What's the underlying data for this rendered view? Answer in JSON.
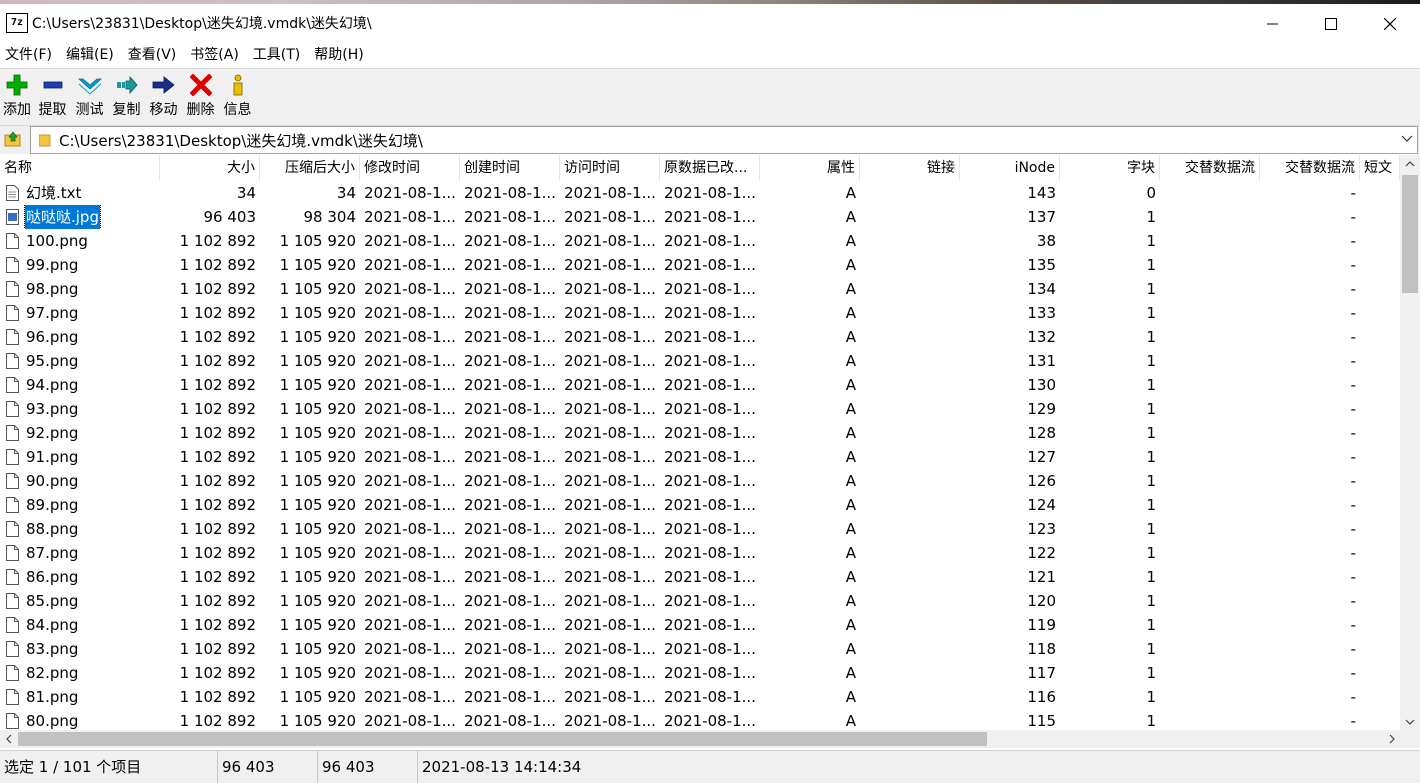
{
  "window": {
    "app_icon_text": "7z",
    "title": "C:\\Users\\23831\\Desktop\\迷失幻境.vmdk\\迷失幻境\\"
  },
  "menu": [
    "文件(F)",
    "编辑(E)",
    "查看(V)",
    "书签(A)",
    "工具(T)",
    "帮助(H)"
  ],
  "toolbar": [
    {
      "label": "添加",
      "icon": "add-icon",
      "color": "#00b000"
    },
    {
      "label": "提取",
      "icon": "extract-icon",
      "color": "#1a3fb5"
    },
    {
      "label": "测试",
      "icon": "test-icon",
      "color": "#00a0c8"
    },
    {
      "label": "复制",
      "icon": "copy-icon",
      "color": "#1a9a9a"
    },
    {
      "label": "移动",
      "icon": "move-icon",
      "color": "#1a2f8a"
    },
    {
      "label": "删除",
      "icon": "delete-icon",
      "color": "#e00000"
    },
    {
      "label": "信息",
      "icon": "info-icon",
      "color": "#e8c000"
    }
  ],
  "address": {
    "path": "C:\\Users\\23831\\Desktop\\迷失幻境.vmdk\\迷失幻境\\"
  },
  "columns": [
    "名称",
    "大小",
    "压缩后大小",
    "修改时间",
    "创建时间",
    "访问时间",
    "原数据已改...",
    "属性",
    "链接",
    "iNode",
    "字块",
    "交替数据流",
    "交替数据流",
    "短文"
  ],
  "rows": [
    {
      "name": "幻境.txt",
      "size": "34",
      "packed": "34",
      "modified": "2021-08-1...",
      "created": "2021-08-1...",
      "accessed": "2021-08-1...",
      "changed": "2021-08-1...",
      "attr": "A",
      "links": "",
      "inode": "143",
      "blocks": "0",
      "alt1": "",
      "alt2": "-",
      "short": "",
      "type": "txt"
    },
    {
      "name": "哒哒哒.jpg",
      "size": "96 403",
      "packed": "98 304",
      "modified": "2021-08-1...",
      "created": "2021-08-1...",
      "accessed": "2021-08-1...",
      "changed": "2021-08-1...",
      "attr": "A",
      "links": "",
      "inode": "137",
      "blocks": "1",
      "alt1": "",
      "alt2": "-",
      "short": "",
      "type": "jpg",
      "selected": true
    },
    {
      "name": "100.png",
      "size": "1 102 892",
      "packed": "1 105 920",
      "modified": "2021-08-1...",
      "created": "2021-08-1...",
      "accessed": "2021-08-1...",
      "changed": "2021-08-1...",
      "attr": "A",
      "links": "",
      "inode": "38",
      "blocks": "1",
      "alt1": "",
      "alt2": "-",
      "short": "",
      "type": "png"
    },
    {
      "name": "99.png",
      "size": "1 102 892",
      "packed": "1 105 920",
      "modified": "2021-08-1...",
      "created": "2021-08-1...",
      "accessed": "2021-08-1...",
      "changed": "2021-08-1...",
      "attr": "A",
      "links": "",
      "inode": "135",
      "blocks": "1",
      "alt1": "",
      "alt2": "-",
      "short": "",
      "type": "png"
    },
    {
      "name": "98.png",
      "size": "1 102 892",
      "packed": "1 105 920",
      "modified": "2021-08-1...",
      "created": "2021-08-1...",
      "accessed": "2021-08-1...",
      "changed": "2021-08-1...",
      "attr": "A",
      "links": "",
      "inode": "134",
      "blocks": "1",
      "alt1": "",
      "alt2": "-",
      "short": "",
      "type": "png"
    },
    {
      "name": "97.png",
      "size": "1 102 892",
      "packed": "1 105 920",
      "modified": "2021-08-1...",
      "created": "2021-08-1...",
      "accessed": "2021-08-1...",
      "changed": "2021-08-1...",
      "attr": "A",
      "links": "",
      "inode": "133",
      "blocks": "1",
      "alt1": "",
      "alt2": "-",
      "short": "",
      "type": "png"
    },
    {
      "name": "96.png",
      "size": "1 102 892",
      "packed": "1 105 920",
      "modified": "2021-08-1...",
      "created": "2021-08-1...",
      "accessed": "2021-08-1...",
      "changed": "2021-08-1...",
      "attr": "A",
      "links": "",
      "inode": "132",
      "blocks": "1",
      "alt1": "",
      "alt2": "-",
      "short": "",
      "type": "png"
    },
    {
      "name": "95.png",
      "size": "1 102 892",
      "packed": "1 105 920",
      "modified": "2021-08-1...",
      "created": "2021-08-1...",
      "accessed": "2021-08-1...",
      "changed": "2021-08-1...",
      "attr": "A",
      "links": "",
      "inode": "131",
      "blocks": "1",
      "alt1": "",
      "alt2": "-",
      "short": "",
      "type": "png"
    },
    {
      "name": "94.png",
      "size": "1 102 892",
      "packed": "1 105 920",
      "modified": "2021-08-1...",
      "created": "2021-08-1...",
      "accessed": "2021-08-1...",
      "changed": "2021-08-1...",
      "attr": "A",
      "links": "",
      "inode": "130",
      "blocks": "1",
      "alt1": "",
      "alt2": "-",
      "short": "",
      "type": "png"
    },
    {
      "name": "93.png",
      "size": "1 102 892",
      "packed": "1 105 920",
      "modified": "2021-08-1...",
      "created": "2021-08-1...",
      "accessed": "2021-08-1...",
      "changed": "2021-08-1...",
      "attr": "A",
      "links": "",
      "inode": "129",
      "blocks": "1",
      "alt1": "",
      "alt2": "-",
      "short": "",
      "type": "png"
    },
    {
      "name": "92.png",
      "size": "1 102 892",
      "packed": "1 105 920",
      "modified": "2021-08-1...",
      "created": "2021-08-1...",
      "accessed": "2021-08-1...",
      "changed": "2021-08-1...",
      "attr": "A",
      "links": "",
      "inode": "128",
      "blocks": "1",
      "alt1": "",
      "alt2": "-",
      "short": "",
      "type": "png"
    },
    {
      "name": "91.png",
      "size": "1 102 892",
      "packed": "1 105 920",
      "modified": "2021-08-1...",
      "created": "2021-08-1...",
      "accessed": "2021-08-1...",
      "changed": "2021-08-1...",
      "attr": "A",
      "links": "",
      "inode": "127",
      "blocks": "1",
      "alt1": "",
      "alt2": "-",
      "short": "",
      "type": "png"
    },
    {
      "name": "90.png",
      "size": "1 102 892",
      "packed": "1 105 920",
      "modified": "2021-08-1...",
      "created": "2021-08-1...",
      "accessed": "2021-08-1...",
      "changed": "2021-08-1...",
      "attr": "A",
      "links": "",
      "inode": "126",
      "blocks": "1",
      "alt1": "",
      "alt2": "-",
      "short": "",
      "type": "png"
    },
    {
      "name": "89.png",
      "size": "1 102 892",
      "packed": "1 105 920",
      "modified": "2021-08-1...",
      "created": "2021-08-1...",
      "accessed": "2021-08-1...",
      "changed": "2021-08-1...",
      "attr": "A",
      "links": "",
      "inode": "124",
      "blocks": "1",
      "alt1": "",
      "alt2": "-",
      "short": "",
      "type": "png"
    },
    {
      "name": "88.png",
      "size": "1 102 892",
      "packed": "1 105 920",
      "modified": "2021-08-1...",
      "created": "2021-08-1...",
      "accessed": "2021-08-1...",
      "changed": "2021-08-1...",
      "attr": "A",
      "links": "",
      "inode": "123",
      "blocks": "1",
      "alt1": "",
      "alt2": "-",
      "short": "",
      "type": "png"
    },
    {
      "name": "87.png",
      "size": "1 102 892",
      "packed": "1 105 920",
      "modified": "2021-08-1...",
      "created": "2021-08-1...",
      "accessed": "2021-08-1...",
      "changed": "2021-08-1...",
      "attr": "A",
      "links": "",
      "inode": "122",
      "blocks": "1",
      "alt1": "",
      "alt2": "-",
      "short": "",
      "type": "png"
    },
    {
      "name": "86.png",
      "size": "1 102 892",
      "packed": "1 105 920",
      "modified": "2021-08-1...",
      "created": "2021-08-1...",
      "accessed": "2021-08-1...",
      "changed": "2021-08-1...",
      "attr": "A",
      "links": "",
      "inode": "121",
      "blocks": "1",
      "alt1": "",
      "alt2": "-",
      "short": "",
      "type": "png"
    },
    {
      "name": "85.png",
      "size": "1 102 892",
      "packed": "1 105 920",
      "modified": "2021-08-1...",
      "created": "2021-08-1...",
      "accessed": "2021-08-1...",
      "changed": "2021-08-1...",
      "attr": "A",
      "links": "",
      "inode": "120",
      "blocks": "1",
      "alt1": "",
      "alt2": "-",
      "short": "",
      "type": "png"
    },
    {
      "name": "84.png",
      "size": "1 102 892",
      "packed": "1 105 920",
      "modified": "2021-08-1...",
      "created": "2021-08-1...",
      "accessed": "2021-08-1...",
      "changed": "2021-08-1...",
      "attr": "A",
      "links": "",
      "inode": "119",
      "blocks": "1",
      "alt1": "",
      "alt2": "-",
      "short": "",
      "type": "png"
    },
    {
      "name": "83.png",
      "size": "1 102 892",
      "packed": "1 105 920",
      "modified": "2021-08-1...",
      "created": "2021-08-1...",
      "accessed": "2021-08-1...",
      "changed": "2021-08-1...",
      "attr": "A",
      "links": "",
      "inode": "118",
      "blocks": "1",
      "alt1": "",
      "alt2": "-",
      "short": "",
      "type": "png"
    },
    {
      "name": "82.png",
      "size": "1 102 892",
      "packed": "1 105 920",
      "modified": "2021-08-1...",
      "created": "2021-08-1...",
      "accessed": "2021-08-1...",
      "changed": "2021-08-1...",
      "attr": "A",
      "links": "",
      "inode": "117",
      "blocks": "1",
      "alt1": "",
      "alt2": "-",
      "short": "",
      "type": "png"
    },
    {
      "name": "81.png",
      "size": "1 102 892",
      "packed": "1 105 920",
      "modified": "2021-08-1...",
      "created": "2021-08-1...",
      "accessed": "2021-08-1...",
      "changed": "2021-08-1...",
      "attr": "A",
      "links": "",
      "inode": "116",
      "blocks": "1",
      "alt1": "",
      "alt2": "-",
      "short": "",
      "type": "png"
    },
    {
      "name": "80.png",
      "size": "1 102 892",
      "packed": "1 105 920",
      "modified": "2021-08-1...",
      "created": "2021-08-1...",
      "accessed": "2021-08-1...",
      "changed": "2021-08-1...",
      "attr": "A",
      "links": "",
      "inode": "115",
      "blocks": "1",
      "alt1": "",
      "alt2": "-",
      "short": "",
      "type": "png"
    }
  ],
  "status": {
    "selection": "选定 1 / 101 个项目",
    "size": "96 403",
    "packed": "96 403",
    "modified": "2021-08-13 14:14:34"
  },
  "colors": {
    "selection_bg": "#0078d7",
    "toolbar_bg": "#f0f0f0"
  }
}
